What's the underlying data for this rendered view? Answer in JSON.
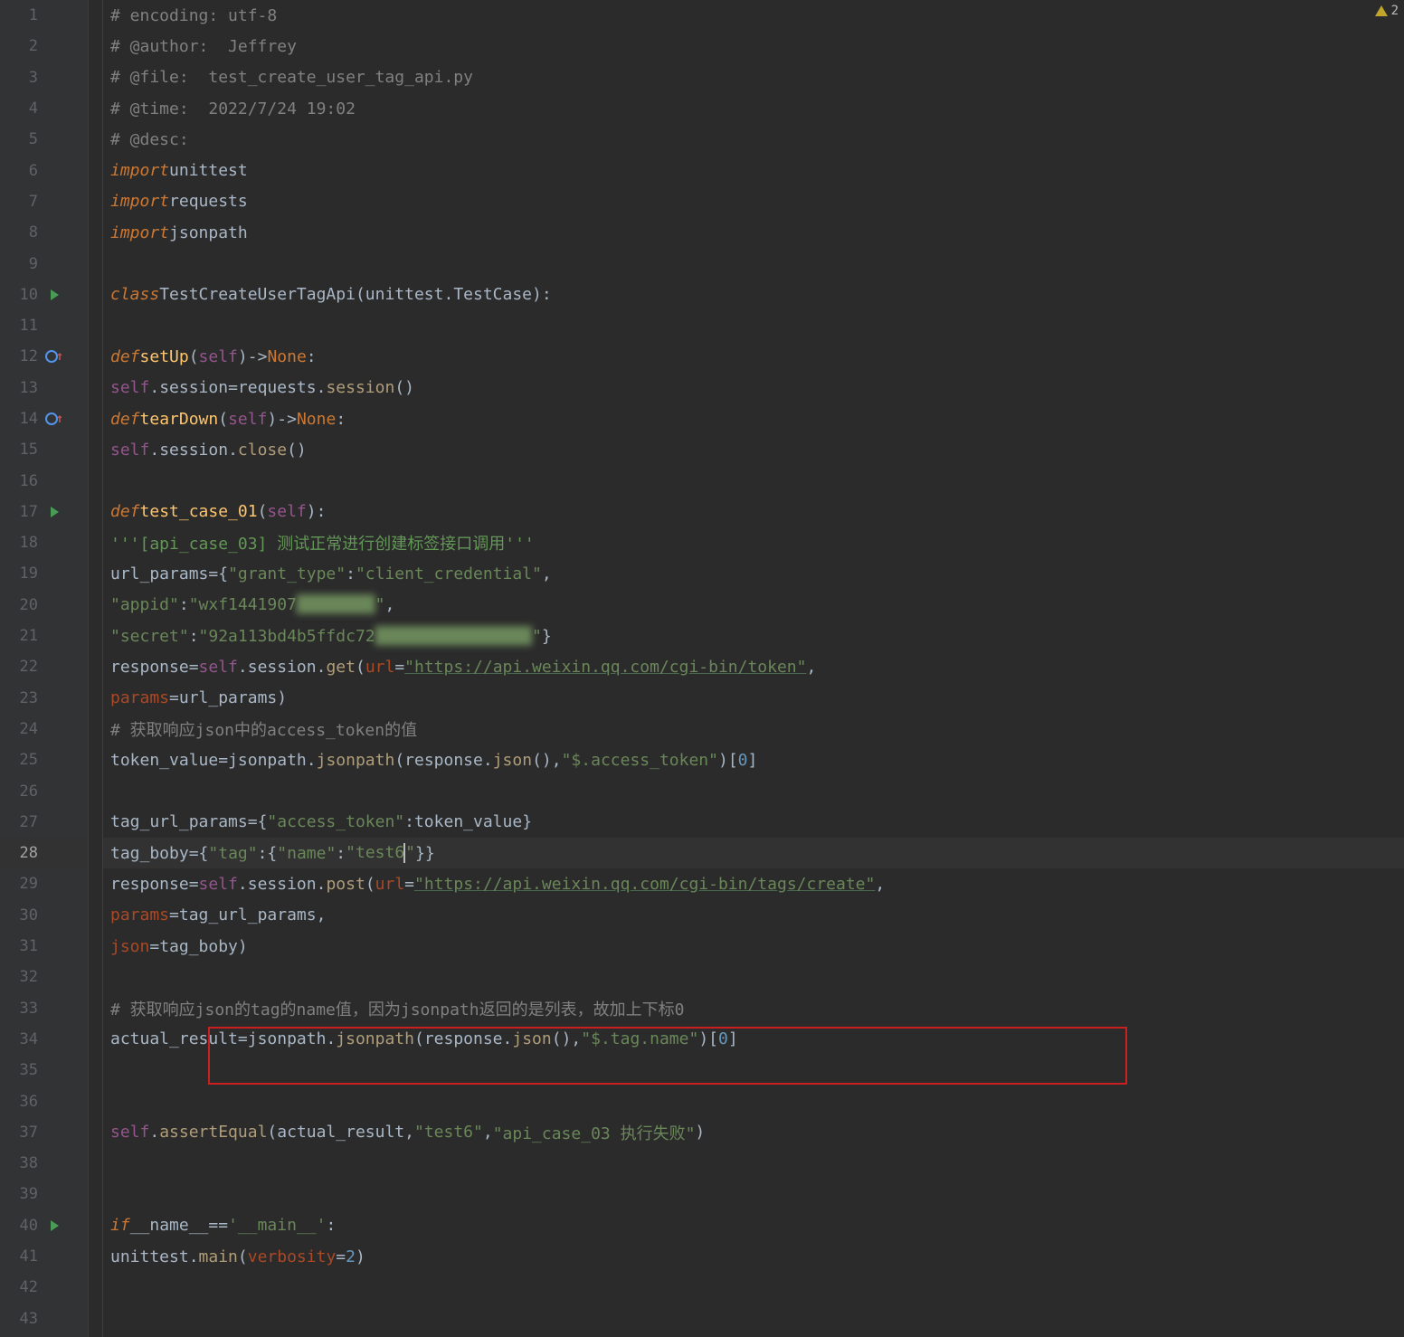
{
  "error_count": "2",
  "lines": [
    {
      "n": 1,
      "html": "<span class='c-comment'># encoding: utf-8</span>"
    },
    {
      "n": 2,
      "html": "<span class='c-comment'># @author:  Jeffrey</span>"
    },
    {
      "n": 3,
      "html": "<span class='c-comment'># @file:  test_create_user_tag_api.py</span>"
    },
    {
      "n": 4,
      "html": "<span class='c-comment'># @time:  2022/7/24 19:02</span>"
    },
    {
      "n": 5,
      "html": "<span class='c-comment'># @desc:</span>"
    },
    {
      "n": 6,
      "html": "<span class='c-keyword-i'>import</span> <span class='c-var'>unittest</span>"
    },
    {
      "n": 7,
      "html": "<span class='c-keyword-i'>import</span> <span class='c-var'>requests</span>"
    },
    {
      "n": 8,
      "html": "<span class='c-keyword-i'>import</span> <span class='c-var'>jsonpath</span>"
    },
    {
      "n": 9,
      "html": ""
    },
    {
      "n": 10,
      "run": true,
      "html": "<span class='c-keyword-i'>class</span> <span class='c-classname'>TestCreateUserTagApi</span><span class='c-punct'>(</span><span class='c-var'>unittest.TestCase</span><span class='c-punct'>):</span>"
    },
    {
      "n": 11,
      "html": ""
    },
    {
      "n": 12,
      "override": true,
      "html": "    <span class='c-keyword-i'>def</span> <span class='c-funcdef'>setUp</span><span class='c-punct'>(</span><span class='c-self'>self</span><span class='c-punct'>)</span> <span class='c-op'>-&gt;</span> <span class='c-keyword'>None</span><span class='c-punct'>:</span>"
    },
    {
      "n": 13,
      "html": "        <span class='c-self'>self</span><span class='c-punct'>.</span><span class='c-var'>session</span> <span class='c-op'>=</span> <span class='c-var'>requests</span><span class='c-punct'>.</span><span class='c-funccall'>session</span><span class='c-punct'>()</span>"
    },
    {
      "n": 14,
      "override": true,
      "html": "    <span class='c-keyword-i'>def</span> <span class='c-funcdef'>tearDown</span><span class='c-punct'>(</span><span class='c-self'>self</span><span class='c-punct'>)</span> <span class='c-op'>-&gt;</span> <span class='c-keyword'>None</span><span class='c-punct'>:</span>"
    },
    {
      "n": 15,
      "html": "        <span class='c-self'>self</span><span class='c-punct'>.</span><span class='c-var'>session</span><span class='c-punct'>.</span><span class='c-funccall'>close</span><span class='c-punct'>()</span>"
    },
    {
      "n": 16,
      "html": ""
    },
    {
      "n": 17,
      "run": true,
      "html": "    <span class='c-keyword-i'>def</span> <span class='c-funcdef'>test_case_01</span><span class='c-punct'>(</span><span class='c-self'>self</span><span class='c-punct'>):</span>"
    },
    {
      "n": 18,
      "html": "        <span class='c-docstring'>'''[api_case_03] 测试正常进行创建标签接口调用'''</span>"
    },
    {
      "n": 19,
      "html": "        <span class='c-var'>url_params</span> <span class='c-op'>=</span> <span class='c-punct'>{</span><span class='c-string'>\"grant_type\"</span><span class='c-punct'>:</span><span class='c-string'>\"client_credential\"</span><span class='c-punct'>,</span>"
    },
    {
      "n": 20,
      "html": "                      <span class='c-string'>\"appid\"</span><span class='c-punct'>:</span><span class='c-string'>\"wxf1441907<span style='filter:blur(4px)'>████████</span>\"</span><span class='c-punct'>,</span>"
    },
    {
      "n": 21,
      "html": "                      <span class='c-string'>\"secret\"</span><span class='c-punct'>:</span><span class='c-string'>\"92a113bd4b5ffdc72<span style='filter:blur(4px)'>████████████████</span>\"</span><span class='c-punct'>}</span>"
    },
    {
      "n": 22,
      "html": "        <span class='c-var'>response</span> <span class='c-op'>=</span> <span class='c-self'>self</span><span class='c-punct'>.</span><span class='c-var'>session</span><span class='c-punct'>.</span><span class='c-funccall'>get</span><span class='c-punct'>(</span><span class='c-param'>url</span><span class='c-op'>=</span><span class='c-url'>\"https://api.weixin.qq.com/cgi-bin/token\"</span><span class='c-punct'>,</span>"
    },
    {
      "n": 23,
      "html": "                                    <span class='c-param'>params</span> <span class='c-op'>=</span> <span class='c-var'>url_params</span><span class='c-punct'>)</span>"
    },
    {
      "n": 24,
      "html": "        <span class='c-comment'># 获取响应json中的access_token的值</span>"
    },
    {
      "n": 25,
      "html": "        <span class='c-var'>token_value</span> <span class='c-op'>=</span> <span class='c-var'>jsonpath</span><span class='c-punct'>.</span><span class='c-funccall'>jsonpath</span><span class='c-punct'>(</span><span class='c-var'>response</span><span class='c-punct'>.</span><span class='c-funccall'>json</span><span class='c-punct'>()</span><span class='c-punct'>,</span> <span class='c-string'>\"$.access_token\"</span><span class='c-punct'>)[</span><span class='c-number'>0</span><span class='c-punct'>]</span>"
    },
    {
      "n": 26,
      "html": ""
    },
    {
      "n": 27,
      "html": "        <span class='c-var'>tag_url_params</span> <span class='c-op'>=</span> <span class='c-punct'>{</span><span class='c-string'>\"access_token\"</span><span class='c-punct'>:</span><span class='c-var'>token_value</span><span class='c-punct'>}</span>"
    },
    {
      "n": 28,
      "current": true,
      "html": "        <span class='c-var'>tag_boby</span> <span class='c-op'>=</span> <span class='c-punct'>{</span> <span class='c-string'>\"tag\"</span><span class='c-punct'>:</span> <span class='c-punct'>{</span> <span class='c-string'>\"name\"</span><span class='c-punct'>:</span><span class='c-string'>\"test6<span class='caret'></span>\"</span> <span class='c-punct'>}</span> <span class='c-punct'>}</span>"
    },
    {
      "n": 29,
      "html": "        <span class='c-var'>response</span> <span class='c-op'>=</span> <span class='c-self'>self</span><span class='c-punct'>.</span><span class='c-var'>session</span><span class='c-punct'>.</span><span class='c-funccall'>post</span><span class='c-punct'>(</span><span class='c-param'>url</span><span class='c-op'>=</span><span class='c-url'>\"https://api.weixin.qq.com/cgi-bin/tags/create\"</span><span class='c-punct'>,</span>"
    },
    {
      "n": 30,
      "html": "                                     <span class='c-param'>params</span> <span class='c-op'>=</span> <span class='c-var'>tag_url_params</span><span class='c-punct'>,</span>"
    },
    {
      "n": 31,
      "html": "                                     <span class='c-param'>json</span><span class='c-op'>=</span><span class='c-var'>tag_boby</span><span class='c-punct'>)</span>"
    },
    {
      "n": 32,
      "html": ""
    },
    {
      "n": 33,
      "html": "        <span class='c-comment'># 获取响应json的tag的name值，因为jsonpath返回的是列表，故加上下标0</span>"
    },
    {
      "n": 34,
      "html": "        <span class='c-var'>actual_result</span> <span class='c-op'>=</span> <span class='c-var'>jsonpath</span><span class='c-punct'>.</span><span class='c-funccall'>jsonpath</span><span class='c-punct'>(</span><span class='c-var'>response</span><span class='c-punct'>.</span><span class='c-funccall'>json</span><span class='c-punct'>()</span><span class='c-punct'>,</span> <span class='c-string'>\"$.tag.name\"</span><span class='c-punct'>)[</span><span class='c-number'>0</span><span class='c-punct'>]</span>"
    },
    {
      "n": 35,
      "html": ""
    },
    {
      "n": 36,
      "html": ""
    },
    {
      "n": 37,
      "html": "        <span class='c-self'>self</span><span class='c-punct'>.</span><span class='c-funccall'>assertEqual</span><span class='c-punct'>(</span><span class='c-var'>actual_result</span><span class='c-punct'>,</span><span class='c-string'>\"test6\"</span><span class='c-punct'>,</span> <span class='c-string'>\"api_case_03 执行失败\"</span><span class='c-punct'>)</span>"
    },
    {
      "n": 38,
      "html": ""
    },
    {
      "n": 39,
      "html": ""
    },
    {
      "n": 40,
      "run": true,
      "html": "<span class='c-keyword-i'>if</span> <span class='c-var'>__name__</span> <span class='c-op'>==</span> <span class='c-string'>'__main__'</span><span class='c-punct'>:</span>"
    },
    {
      "n": 41,
      "html": "    <span class='c-var'>unittest</span><span class='c-punct'>.</span><span class='c-funccall'>main</span><span class='c-punct'>(</span><span class='c-param'>verbosity</span><span class='c-op'>=</span><span class='c-number'>2</span><span class='c-punct'>)</span>"
    },
    {
      "n": 42,
      "html": ""
    },
    {
      "n": 43,
      "html": ""
    }
  ]
}
